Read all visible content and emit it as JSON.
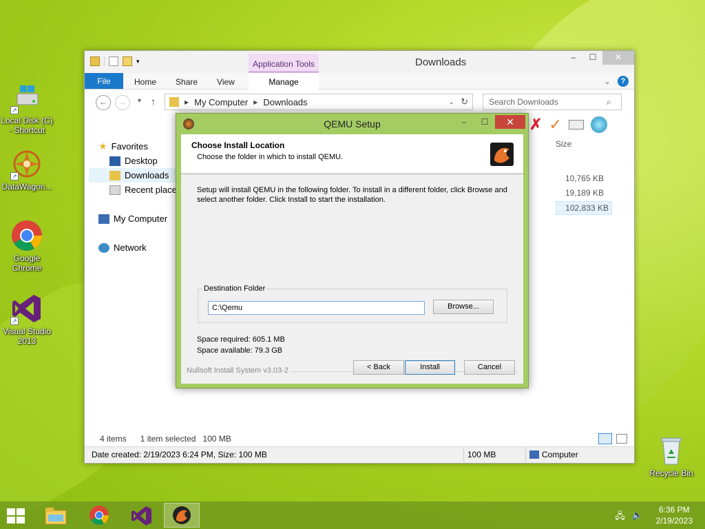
{
  "desktop": {
    "icons": [
      {
        "label_line1": "Local Disk (C)",
        "label_line2": "- Shortcut"
      },
      {
        "label_line1": "DataWagon...",
        "label_line2": ""
      },
      {
        "label_line1": "Google",
        "label_line2": "Chrome"
      },
      {
        "label_line1": "Visual Studio",
        "label_line2": "2013"
      },
      {
        "label_line1": "Recycle Bin",
        "label_line2": ""
      }
    ]
  },
  "explorer": {
    "title": "Downloads",
    "context_tab": "Application Tools",
    "tabs": {
      "file": "File",
      "home": "Home",
      "share": "Share",
      "view": "View",
      "manage": "Manage"
    },
    "breadcrumb": [
      "My Computer",
      "Downloads"
    ],
    "search_placeholder": "Search Downloads",
    "nav": {
      "favorites": "Favorites",
      "desktop": "Desktop",
      "downloads": "Downloads",
      "recent": "Recent places",
      "computer": "My Computer",
      "network": "Network"
    },
    "size_header": "Size",
    "sizes": [
      "10,765 KB",
      "19,189 KB",
      "102,833 KB"
    ],
    "status": {
      "items": "4 items",
      "selected": "1 item selected",
      "selected_size": "100 MB"
    },
    "details": {
      "info": "Date created: 2/19/2023 6:24 PM, Size: 100 MB",
      "size": "100 MB",
      "location": "Computer"
    }
  },
  "dialog": {
    "title": "QEMU Setup",
    "heading": "Choose Install Location",
    "subheading": "Choose the folder in which to install QEMU.",
    "description": "Setup will install QEMU in the following folder. To install in a different folder, click Browse and select another folder. Click Install to start the installation.",
    "dest_label": "Destination Folder",
    "dest_value": "C:\\Qemu",
    "browse": "Browse...",
    "space_required": "Space required: 605.1 MB",
    "space_available": "Space available: 79.3 GB",
    "nsis": "Nullsoft Install System v3.03-2",
    "back": "< Back",
    "install": "Install",
    "cancel": "Cancel"
  },
  "taskbar": {
    "time": "6:36 PM",
    "date": "2/19/2023"
  }
}
